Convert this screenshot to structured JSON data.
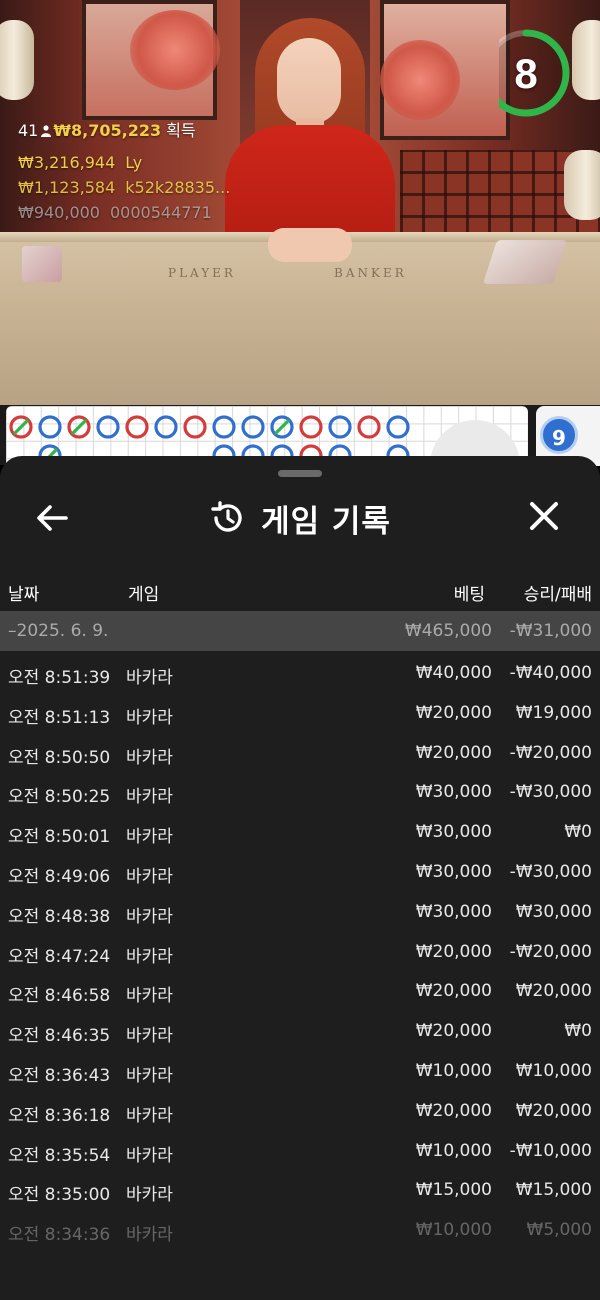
{
  "live": {
    "winners_count": "41",
    "winners_total": "₩8,705,223",
    "winners_label": "획득",
    "recent_wins": [
      {
        "amount": "₩3,216,944",
        "user": "Ly"
      },
      {
        "amount": "₩1,123,584",
        "user": "k52k28835..."
      },
      {
        "amount": "₩940,000",
        "user": "0000544771"
      }
    ],
    "table_labels": {
      "player": "PLAYER",
      "banker": "BANKER"
    },
    "countdown": "8",
    "countdown_progress": 0.75,
    "road_next_badge": "9"
  },
  "history": {
    "title": "게임 기록",
    "columns": {
      "date": "날짜",
      "game": "게임",
      "bet": "베팅",
      "win_loss": "승리/패배"
    },
    "date_group": {
      "date": "–2025. 6. 9.",
      "bet_total": "₩465,000",
      "win_loss_total": "-₩31,000"
    },
    "rows": [
      {
        "time": "오전 8:51:39",
        "game": "바카라",
        "bet": "₩40,000",
        "win_loss": "-₩40,000"
      },
      {
        "time": "오전 8:51:13",
        "game": "바카라",
        "bet": "₩20,000",
        "win_loss": "₩19,000"
      },
      {
        "time": "오전 8:50:50",
        "game": "바카라",
        "bet": "₩20,000",
        "win_loss": "-₩20,000"
      },
      {
        "time": "오전 8:50:25",
        "game": "바카라",
        "bet": "₩30,000",
        "win_loss": "-₩30,000"
      },
      {
        "time": "오전 8:50:01",
        "game": "바카라",
        "bet": "₩30,000",
        "win_loss": "₩0"
      },
      {
        "time": "오전 8:49:06",
        "game": "바카라",
        "bet": "₩30,000",
        "win_loss": "-₩30,000"
      },
      {
        "time": "오전 8:48:38",
        "game": "바카라",
        "bet": "₩30,000",
        "win_loss": "₩30,000"
      },
      {
        "time": "오전 8:47:24",
        "game": "바카라",
        "bet": "₩20,000",
        "win_loss": "-₩20,000"
      },
      {
        "time": "오전 8:46:58",
        "game": "바카라",
        "bet": "₩20,000",
        "win_loss": "₩20,000"
      },
      {
        "time": "오전 8:46:35",
        "game": "바카라",
        "bet": "₩20,000",
        "win_loss": "₩0"
      },
      {
        "time": "오전 8:36:43",
        "game": "바카라",
        "bet": "₩10,000",
        "win_loss": "₩10,000"
      },
      {
        "time": "오전 8:36:18",
        "game": "바카라",
        "bet": "₩20,000",
        "win_loss": "₩20,000"
      },
      {
        "time": "오전 8:35:54",
        "game": "바카라",
        "bet": "₩10,000",
        "win_loss": "-₩10,000"
      },
      {
        "time": "오전 8:35:00",
        "game": "바카라",
        "bet": "₩15,000",
        "win_loss": "₩15,000"
      },
      {
        "time": "오전 8:34:36",
        "game": "바카라",
        "bet": "₩10,000",
        "win_loss": "₩5,000"
      }
    ]
  },
  "colors": {
    "sheet_bg": "#1e1e1e",
    "date_row_bg": "#454545",
    "win_gold": "#f2cf45",
    "timer_green": "#2fb54a",
    "banker_red": "#d63a3a",
    "player_blue": "#2f6fd0",
    "tie_green": "#2fb54a"
  },
  "icons": {
    "back": "arrow-left-icon",
    "history": "history-icon",
    "close": "close-icon",
    "person": "person-icon"
  }
}
